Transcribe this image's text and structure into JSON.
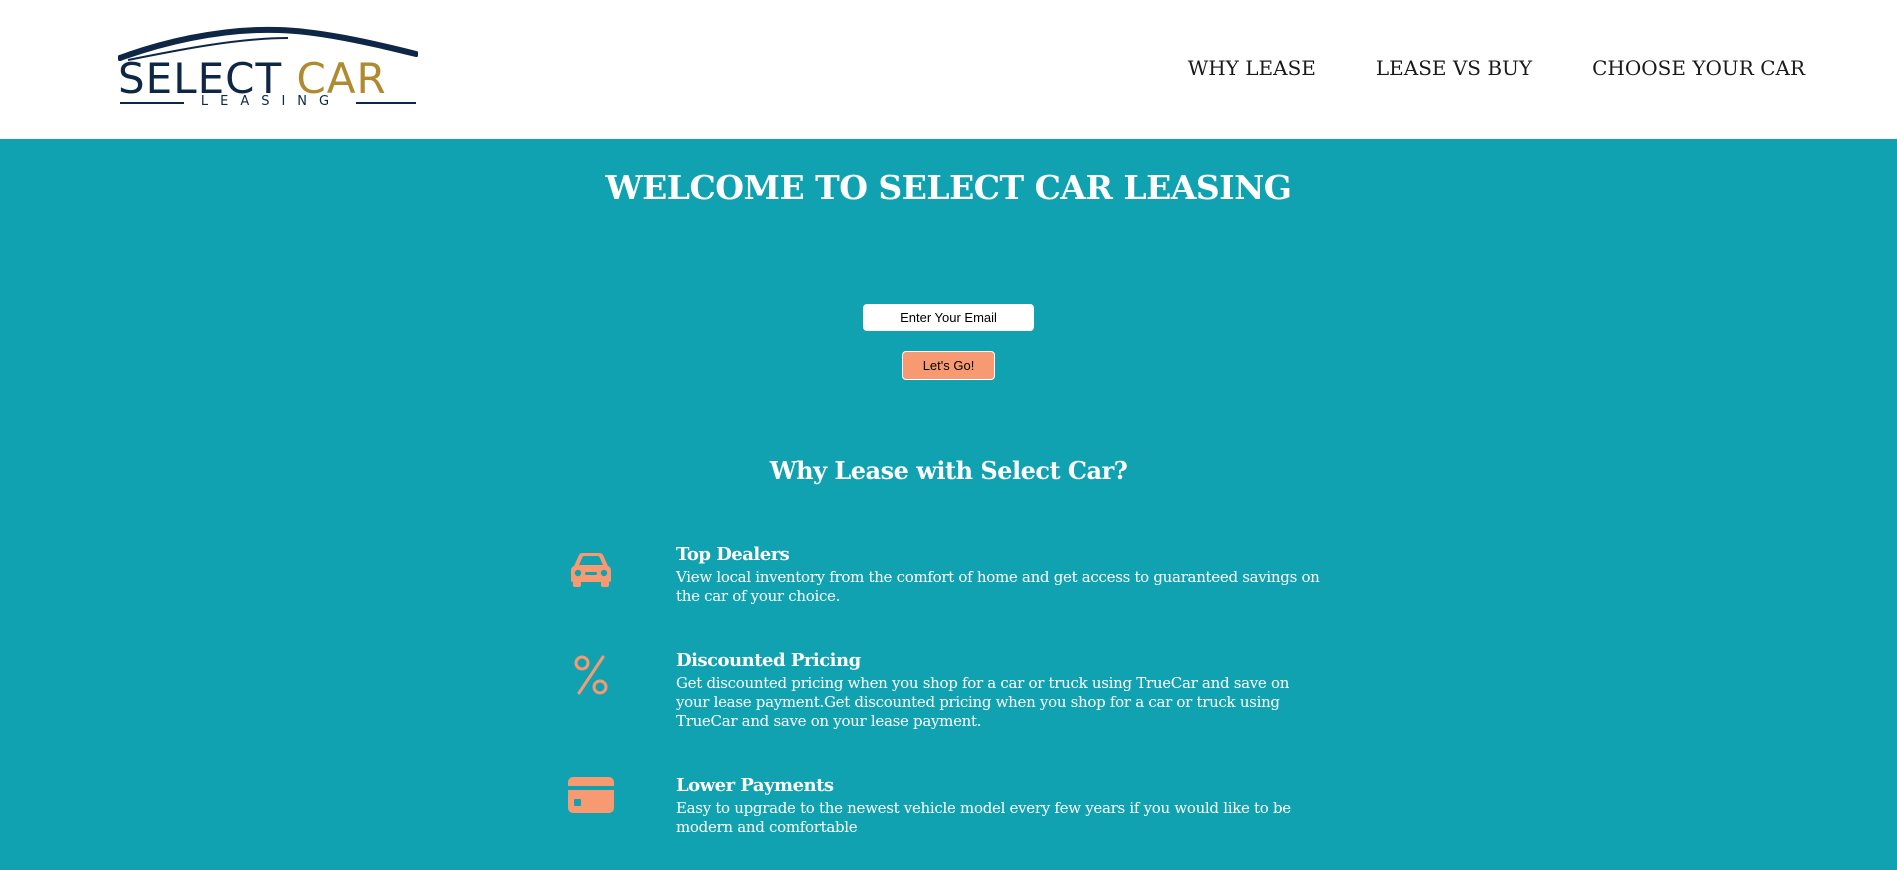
{
  "header": {
    "logo": {
      "word1": "SELECT",
      "word2": "CAR",
      "tagline": "LEASING",
      "colors": {
        "navy": "#0e2747",
        "gold": "#b08a2e"
      }
    },
    "nav": [
      {
        "label": "WHY LEASE"
      },
      {
        "label": "LEASE VS BUY"
      },
      {
        "label": "CHOOSE YOUR CAR"
      }
    ]
  },
  "hero": {
    "title": "WELCOME TO SELECT CAR LEASING",
    "email_placeholder": "Enter Your Email",
    "submit_label": "Let's Go!"
  },
  "why": {
    "title": "Why Lease with Select Car?",
    "features": [
      {
        "icon": "car-icon",
        "title": "Top Dealers",
        "text": "View local inventory from the comfort of home and get access to guaranteed savings on the car of your choice."
      },
      {
        "icon": "percent-icon",
        "title": "Discounted Pricing",
        "text": "Get discounted pricing when you shop for a car or truck using TrueCar and save on your lease payment.Get discounted pricing when you shop for a car or truck using TrueCar and save on your lease payment."
      },
      {
        "icon": "credit-card-icon",
        "title": "Lower Payments",
        "text": "Easy to upgrade to the newest vehicle model every few years if you would like to be modern and comfortable"
      }
    ]
  },
  "colors": {
    "background": "#11a2b2",
    "accent": "#f79a72",
    "header_bg": "#ffffff",
    "text_light": "#ffffff"
  }
}
